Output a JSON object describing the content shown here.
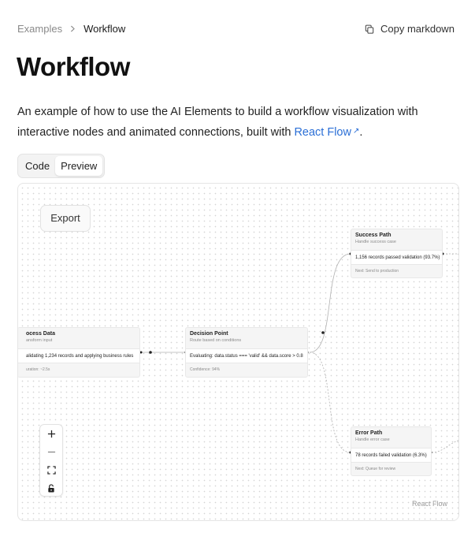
{
  "breadcrumb": {
    "parent": "Examples",
    "current": "Workflow"
  },
  "header": {
    "copy_label": "Copy markdown"
  },
  "page": {
    "title": "Workflow",
    "description_before": "An example of how to use the AI Elements to build a workflow visualization with interactive nodes and animated connections, built with ",
    "link_text": "React Flow",
    "description_after": "."
  },
  "tabs": [
    {
      "label": "Code"
    },
    {
      "label": "Preview",
      "active": true
    }
  ],
  "preview": {
    "export_label": "Export",
    "attribution": "React Flow",
    "nodes": {
      "process": {
        "title": "ocess Data",
        "subtitle": "ansform input",
        "body": "alidating 1,234 records and applying business rules",
        "footer": "uration: ~2.5s"
      },
      "decision": {
        "title": "Decision Point",
        "subtitle": "Route based on conditions",
        "body": "Evaluating: data.status === 'valid' && data.score > 0.8",
        "footer": "Confidence: 94%"
      },
      "success": {
        "title": "Success Path",
        "subtitle": "Handle success case",
        "body": "1,156 records passed validation (93.7%)",
        "footer": "Next: Send to production"
      },
      "error": {
        "title": "Error Path",
        "subtitle": "Handle error case",
        "body": "78 records failed validation (6.3%)",
        "footer": "Next: Queue for review"
      }
    },
    "controls": [
      "zoom-in",
      "zoom-out",
      "fit-view",
      "lock"
    ]
  },
  "colors": {
    "link": "#2b6fd6",
    "text": "#111111",
    "muted": "#8a8a8a",
    "node_bg": "#f5f5f5",
    "edge": "#b0b0b0"
  }
}
